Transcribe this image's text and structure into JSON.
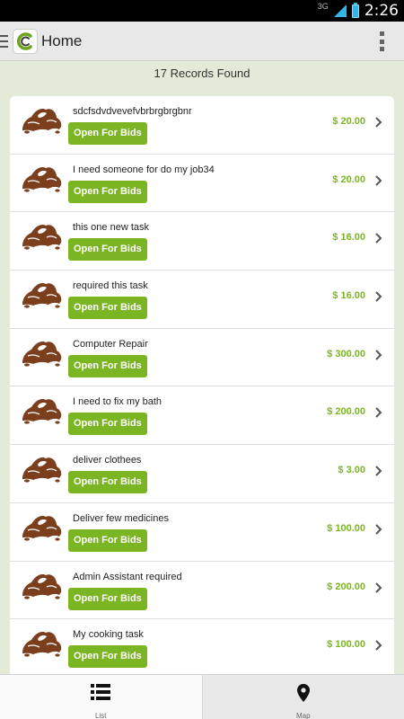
{
  "status_bar": {
    "network": "3G",
    "time": "2:26"
  },
  "app_bar": {
    "title": "Home"
  },
  "records_found": "17 Records Found",
  "tasks": [
    {
      "title": "sdcfsdvdvevefvbrbrgbrgbnr",
      "status": "Open For Bids",
      "price": "$ 20.00"
    },
    {
      "title": "I need someone for do my job34",
      "status": "Open For Bids",
      "price": "$ 20.00"
    },
    {
      "title": "this one new task",
      "status": "Open For Bids",
      "price": "$ 16.00"
    },
    {
      "title": "required this task",
      "status": "Open For Bids",
      "price": "$ 16.00"
    },
    {
      "title": "Computer Repair",
      "status": "Open For Bids",
      "price": "$ 300.00"
    },
    {
      "title": "I need to fix my bath",
      "status": "Open For Bids",
      "price": "$ 200.00"
    },
    {
      "title": "deliver clothees",
      "status": "Open For Bids",
      "price": "$ 3.00"
    },
    {
      "title": "Deliver few medicines",
      "status": "Open For Bids",
      "price": "$ 100.00"
    },
    {
      "title": "Admin Assistant required",
      "status": "Open For Bids",
      "price": "$ 200.00"
    },
    {
      "title": "My cooking task",
      "status": "Open For Bids",
      "price": "$ 100.00"
    }
  ],
  "bottom_tabs": [
    {
      "label": "List",
      "icon": "list-icon",
      "active": true
    },
    {
      "label": "Map",
      "icon": "map-pin-icon",
      "active": false
    }
  ],
  "colors": {
    "accent": "#7cb524",
    "status_bar": "#000000",
    "app_bar": "#e8e8e8",
    "background": "#e3ead8"
  }
}
